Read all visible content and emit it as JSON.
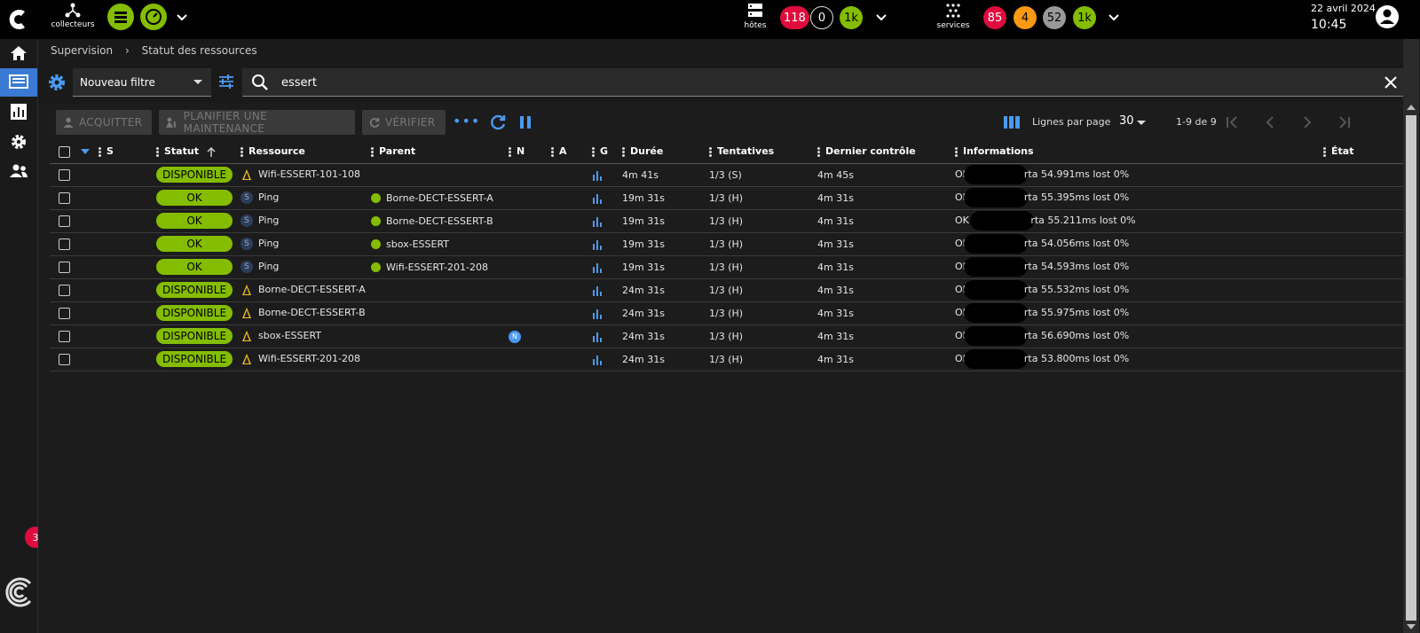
{
  "topbar": {
    "collectors_label": "collecteurs",
    "hosts_label": "hôtes",
    "hosts_badges": [
      "118",
      "0",
      "1k"
    ],
    "services_label": "services",
    "services_badges": [
      "85",
      "4",
      "52",
      "1k"
    ],
    "date": "22 avril 2024",
    "time": "10:45"
  },
  "sidebar": {
    "notification_count": "3"
  },
  "breadcrumb": {
    "parent": "Supervision",
    "current": "Statut des ressources"
  },
  "filter": {
    "selected": "Nouveau filtre",
    "search_value": "essert"
  },
  "actions": {
    "acknowledge": "ACQUITTER",
    "downtime": "PLANIFIER UNE MAINTENANCE",
    "check": "VÉRIFIER"
  },
  "pagination": {
    "rows_per_page_label": "Lignes par page",
    "rows_per_page": "30",
    "range": "1-9 de 9"
  },
  "columns": {
    "s": "S",
    "status": "Statut",
    "resource": "Ressource",
    "parent": "Parent",
    "n": "N",
    "a": "A",
    "g": "G",
    "duration": "Durée",
    "tries": "Tentatives",
    "last_check": "Dernier contrôle",
    "information": "Informations",
    "state": "État"
  },
  "rows": [
    {
      "status": "DISPONIBLE",
      "type": "host",
      "resource": "Wifi-ESSERT-101-108",
      "parent": "",
      "n": "",
      "duration": "4m 41s",
      "tries": "1/3 (S)",
      "last_check": "4m 45s",
      "info_start": "OK",
      "info_end": "rta 54.991ms lost 0%"
    },
    {
      "status": "OK",
      "type": "service",
      "resource": "Ping",
      "parent": "Borne-DECT-ESSERT-A",
      "n": "",
      "duration": "19m 31s",
      "tries": "1/3 (H)",
      "last_check": "4m 31s",
      "info_start": "OK",
      "info_end": "rta 55.395ms lost 0%"
    },
    {
      "status": "OK",
      "type": "service",
      "resource": "Ping",
      "parent": "Borne-DECT-ESSERT-B",
      "n": "",
      "duration": "19m 31s",
      "tries": "1/3 (H)",
      "last_check": "4m 31s",
      "info_start": "OK -",
      "info_end": "rta 55.211ms lost 0%"
    },
    {
      "status": "OK",
      "type": "service",
      "resource": "Ping",
      "parent": "sbox-ESSERT",
      "n": "",
      "duration": "19m 31s",
      "tries": "1/3 (H)",
      "last_check": "4m 31s",
      "info_start": "OK",
      "info_end": "rta 54.056ms lost 0%"
    },
    {
      "status": "OK",
      "type": "service",
      "resource": "Ping",
      "parent": "Wifi-ESSERT-201-208",
      "n": "",
      "duration": "19m 31s",
      "tries": "1/3 (H)",
      "last_check": "4m 31s",
      "info_start": "OK",
      "info_end": "rta 54.593ms lost 0%"
    },
    {
      "status": "DISPONIBLE",
      "type": "host",
      "resource": "Borne-DECT-ESSERT-A",
      "parent": "",
      "n": "",
      "duration": "24m 31s",
      "tries": "1/3 (H)",
      "last_check": "4m 31s",
      "info_start": "OK",
      "info_end": "rta 55.532ms lost 0%"
    },
    {
      "status": "DISPONIBLE",
      "type": "host",
      "resource": "Borne-DECT-ESSERT-B",
      "parent": "",
      "n": "",
      "duration": "24m 31s",
      "tries": "1/3 (H)",
      "last_check": "4m 31s",
      "info_start": "OK",
      "info_end": "rta 55.975ms lost 0%"
    },
    {
      "status": "DISPONIBLE",
      "type": "host",
      "resource": "sbox-ESSERT",
      "parent": "",
      "n": "N",
      "duration": "24m 31s",
      "tries": "1/3 (H)",
      "last_check": "4m 31s",
      "info_start": "OK",
      "info_end": "rta 56.690ms lost 0%"
    },
    {
      "status": "DISPONIBLE",
      "type": "host",
      "resource": "Wifi-ESSERT-201-208",
      "parent": "",
      "n": "",
      "duration": "24m 31s",
      "tries": "1/3 (H)",
      "last_check": "4m 31s",
      "info_start": "OK",
      "info_end": "rta 53.800ms lost 0%"
    }
  ],
  "colors": {
    "ok_green": "#84bd00",
    "critical_red": "#e00b3d",
    "warning_orange": "#ff9913",
    "unknown_grey": "#999999",
    "accent_blue": "#4a9af0"
  }
}
